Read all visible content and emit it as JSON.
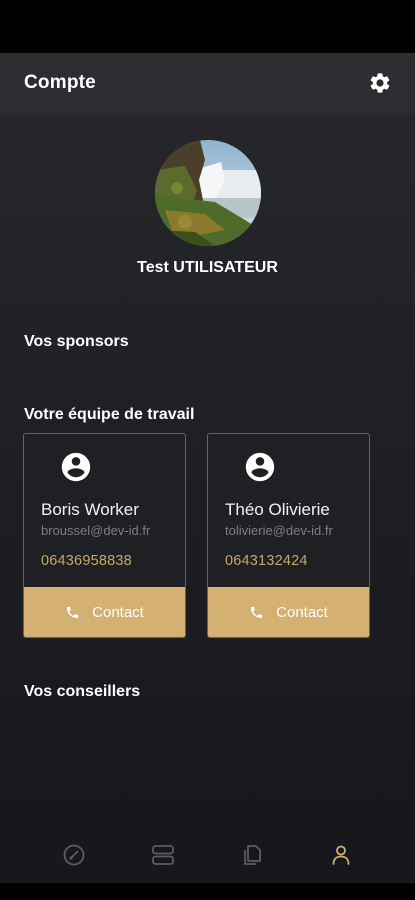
{
  "header": {
    "title": "Compte",
    "settings_icon": "gear-icon"
  },
  "profile": {
    "name": "Test UTILISATEUR",
    "avatar": "waterfall-landscape-photo"
  },
  "sections": {
    "sponsors": "Vos sponsors",
    "team": "Votre équipe de travail",
    "advisors": "Vos conseillers"
  },
  "team": [
    {
      "name": "Boris Worker",
      "email": "broussel@dev-id.fr",
      "phone": "06436958838",
      "button": "Contact"
    },
    {
      "name": "Théo Olivierie",
      "email": "tolivierie@dev-id.fr",
      "phone": "0643132424",
      "button": "Contact"
    }
  ],
  "nav": {
    "items": [
      {
        "icon": "dashboard-gauge-icon",
        "active": false
      },
      {
        "icon": "list-stack-icon",
        "active": false
      },
      {
        "icon": "documents-icon",
        "active": false
      },
      {
        "icon": "profile-icon",
        "active": true
      }
    ]
  },
  "colors": {
    "accent": "#d4b072",
    "phone": "#c8a866",
    "app_bar": "#2c2d31",
    "background": "#1d1e22"
  }
}
